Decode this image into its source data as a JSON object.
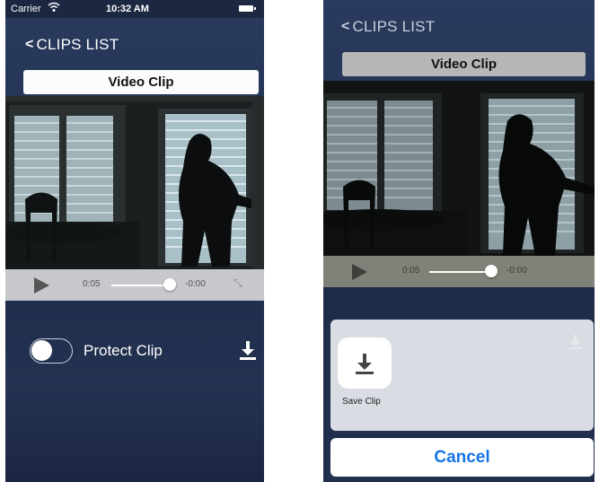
{
  "status_bar": {
    "carrier": "Carrier",
    "time": "10:32 AM",
    "wifi_icon": "wifi-icon",
    "battery_icon": "battery-icon"
  },
  "left_screen": {
    "nav": {
      "back_label": "CLIPS LIST",
      "back_icon": "chevron-left-icon"
    },
    "title": "Video Clip",
    "player": {
      "current_time": "0:05",
      "remaining_time": "-0:00",
      "progress": 0.75,
      "play_icon": "play-icon",
      "expand_icon": "expand-icon"
    },
    "protect_clip": {
      "label": "Protect Clip",
      "enabled": false
    },
    "download_icon": "download-icon"
  },
  "right_screen": {
    "nav": {
      "back_label": "CLIPS LIST"
    },
    "title": "Video Clip",
    "player": {
      "current_time": "0:05",
      "remaining_time": "-0:00",
      "progress": 0.75
    },
    "share_sheet": {
      "save_label": "Save Clip",
      "save_icon": "download-icon",
      "cancel_label": "Cancel"
    }
  },
  "colors": {
    "accent_blue": "#1474e6",
    "nav_background": "#243455"
  }
}
